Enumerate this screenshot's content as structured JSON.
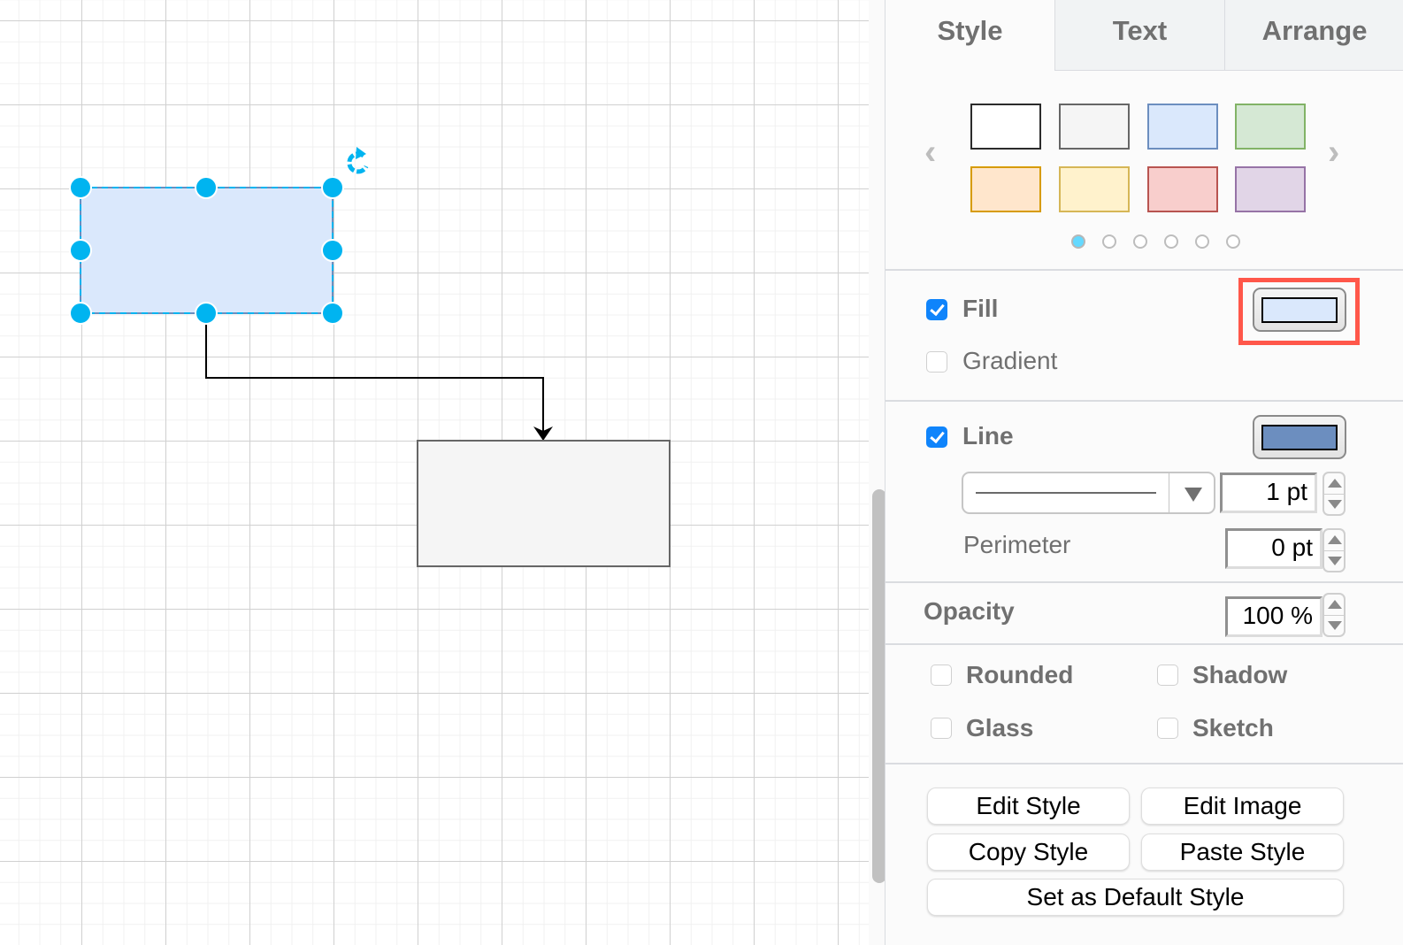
{
  "canvas": {
    "shapes": [
      {
        "name": "selected-rectangle",
        "fill": "#dae8fc",
        "stroke": "#6c8ebf",
        "selected": true
      },
      {
        "name": "target-rectangle",
        "fill": "#f5f5f5",
        "stroke": "#666666",
        "selected": false
      }
    ],
    "connector": {
      "from": "selected-rectangle",
      "to": "target-rectangle",
      "style": "orthogonal",
      "end_arrow": "classic"
    },
    "selection_color": "#00b4f0",
    "icons": {
      "rotate": "rotate-icon"
    }
  },
  "panel": {
    "tabs": [
      {
        "label": "Style",
        "active": true
      },
      {
        "label": "Text",
        "active": false
      },
      {
        "label": "Arrange",
        "active": false
      }
    ],
    "swatches": [
      {
        "fill": "#ffffff",
        "stroke": "#2b2b2b"
      },
      {
        "fill": "#f5f5f5",
        "stroke": "#666666"
      },
      {
        "fill": "#dae8fc",
        "stroke": "#6c8ebf"
      },
      {
        "fill": "#d5e8d4",
        "stroke": "#82b366"
      },
      {
        "fill": "#ffe6cc",
        "stroke": "#d79b00"
      },
      {
        "fill": "#fff2cc",
        "stroke": "#d6b656"
      },
      {
        "fill": "#f8cecc",
        "stroke": "#b85450"
      },
      {
        "fill": "#e1d5e7",
        "stroke": "#9673a6"
      }
    ],
    "swatch_nav": {
      "prev_glyph": "‹",
      "next_glyph": "›"
    },
    "swatch_pages": {
      "count": 6,
      "active": 1
    },
    "fill": {
      "label": "Fill",
      "checked": true,
      "color": "#dae8fc"
    },
    "gradient": {
      "label": "Gradient",
      "checked": false
    },
    "line": {
      "label": "Line",
      "checked": true,
      "color": "#6c8ebf",
      "pattern": "solid",
      "width_value": "1 pt"
    },
    "perimeter": {
      "label": "Perimeter",
      "value": "0 pt"
    },
    "opacity": {
      "label": "Opacity",
      "value": "100 %"
    },
    "options": [
      {
        "label": "Rounded",
        "checked": false
      },
      {
        "label": "Shadow",
        "checked": false
      },
      {
        "label": "Glass",
        "checked": false
      },
      {
        "label": "Sketch",
        "checked": false
      }
    ],
    "buttons": {
      "edit_style": "Edit Style",
      "edit_image": "Edit Image",
      "copy_style": "Copy Style",
      "paste_style": "Paste Style",
      "set_default": "Set as Default Style"
    },
    "highlight_color": "#ff574a"
  }
}
